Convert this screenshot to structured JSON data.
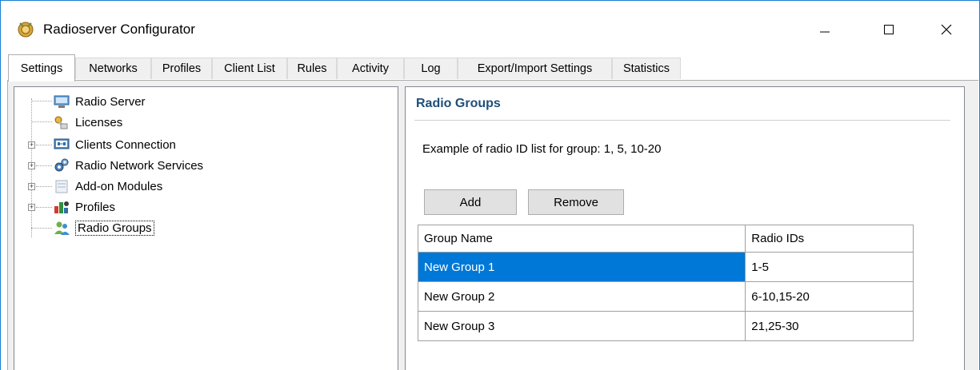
{
  "window": {
    "title": "Radioserver Configurator"
  },
  "tabs": [
    {
      "label": "Settings",
      "active": true
    },
    {
      "label": "Networks"
    },
    {
      "label": "Profiles"
    },
    {
      "label": "Client List"
    },
    {
      "label": "Rules"
    },
    {
      "label": "Activity"
    },
    {
      "label": "Log"
    },
    {
      "label": "Export/Import Settings"
    },
    {
      "label": "Statistics"
    }
  ],
  "tree": {
    "items": [
      {
        "label": "Radio Server",
        "icon": "server-icon"
      },
      {
        "label": "Licenses",
        "icon": "key-icon"
      },
      {
        "label": "Clients Connection",
        "icon": "network-icon",
        "expandable": true
      },
      {
        "label": "Radio Network Services",
        "icon": "gears-icon",
        "expandable": true
      },
      {
        "label": "Add-on Modules",
        "icon": "module-icon",
        "expandable": true
      },
      {
        "label": "Profiles",
        "icon": "profiles-icon",
        "expandable": true
      },
      {
        "label": "Radio Groups",
        "icon": "users-icon",
        "selected": true
      }
    ]
  },
  "panel": {
    "title": "Radio Groups",
    "hint": "Example of radio ID list for group: 1, 5, 10-20",
    "add_label": "Add",
    "remove_label": "Remove",
    "columns": [
      "Group Name",
      "Radio IDs"
    ],
    "rows": [
      {
        "name": "New Group 1",
        "ids": "1-5",
        "selected": true
      },
      {
        "name": "New Group 2",
        "ids": "6-10,15-20"
      },
      {
        "name": "New Group 3",
        "ids": "21,25-30"
      }
    ]
  },
  "colors": {
    "accent": "#0078d7",
    "title_blue": "#1e4e79"
  }
}
